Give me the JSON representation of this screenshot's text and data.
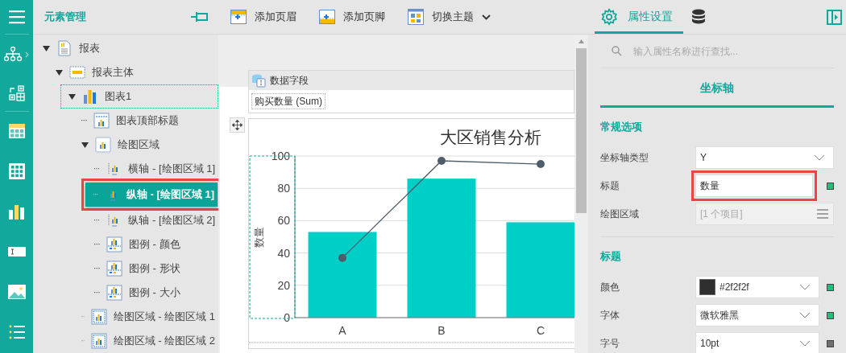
{
  "panel": {
    "title": "元素管理"
  },
  "tree": [
    {
      "label": "报表",
      "kind": "report",
      "expanded": true,
      "selected": false,
      "focused": false,
      "annotated": false,
      "children": [
        {
          "label": "报表主体",
          "kind": "body",
          "expanded": true,
          "selected": false,
          "focused": false,
          "annotated": false,
          "children": [
            {
              "label": "图表1",
              "kind": "chart",
              "expanded": true,
              "selected": false,
              "focused": true,
              "annotated": false,
              "children": [
                {
                  "label": "图表顶部标题",
                  "kind": "chart-title",
                  "expanded": false,
                  "selected": false,
                  "focused": false,
                  "annotated": false
                },
                {
                  "label": "绘图区域",
                  "kind": "plot",
                  "expanded": true,
                  "selected": false,
                  "focused": false,
                  "annotated": false,
                  "children": [
                    {
                      "label": "横轴 - [绘图区域 1]",
                      "kind": "axis",
                      "expanded": false,
                      "selected": false,
                      "focused": false,
                      "annotated": false
                    },
                    {
                      "label": "纵轴 - [绘图区域 1]",
                      "kind": "axis",
                      "expanded": false,
                      "selected": true,
                      "focused": false,
                      "annotated": true
                    },
                    {
                      "label": "纵轴 - [绘图区域 2]",
                      "kind": "axis",
                      "expanded": false,
                      "selected": false,
                      "focused": false,
                      "annotated": false
                    },
                    {
                      "label": "图例 - 颜色",
                      "kind": "legend",
                      "expanded": false,
                      "selected": false,
                      "focused": false,
                      "annotated": false
                    },
                    {
                      "label": "图例 - 形状",
                      "kind": "legend",
                      "expanded": false,
                      "selected": false,
                      "focused": false,
                      "annotated": false
                    },
                    {
                      "label": "图例 - 大小",
                      "kind": "legend",
                      "expanded": false,
                      "selected": false,
                      "focused": false,
                      "annotated": false
                    }
                  ]
                },
                {
                  "label": "绘图区域 - 绘图区域 1",
                  "kind": "plot-area",
                  "expanded": false,
                  "selected": false,
                  "focused": false,
                  "annotated": false
                },
                {
                  "label": "绘图区域 - 绘图区域 2",
                  "kind": "plot-area",
                  "expanded": false,
                  "selected": false,
                  "focused": false,
                  "annotated": false
                }
              ]
            }
          ]
        }
      ]
    }
  ],
  "toolbar": [
    {
      "label": "添加页眉",
      "kind": "header"
    },
    {
      "label": "添加页脚",
      "kind": "footer"
    },
    {
      "label": "切换主题",
      "kind": "theme"
    }
  ],
  "data_fields": {
    "title": "数据字段",
    "fields": [
      "购买数量 (Sum)"
    ]
  },
  "chart": {
    "chart_data": {
      "type": "bar",
      "grid": true,
      "title": "大区销售分析",
      "ylabel": "数量",
      "categories": [
        "A",
        "B",
        "C"
      ],
      "ylim": [
        0,
        100
      ],
      "yticks": [
        0,
        20,
        40,
        60,
        80,
        100
      ],
      "series": [
        {
          "type": "bar",
          "color": "#00cfc8",
          "values": [
            53,
            86,
            59
          ]
        },
        {
          "type": "line",
          "color": "#4f5d6b",
          "marker": "circle",
          "values": [
            37,
            97,
            95
          ]
        }
      ]
    }
  },
  "properties": {
    "tabs": [
      {
        "label": "属性设置",
        "kind": "settings",
        "selected": true
      },
      {
        "kind": "data",
        "selected": false
      }
    ],
    "search": {
      "placeholder": "输入属性名称进行查找..."
    },
    "section_tab": "坐标轴",
    "groups": [
      {
        "title": "常规选项",
        "rows": [
          {
            "label": "坐标轴类型",
            "kind": "select",
            "value": "Y",
            "annotated": false
          },
          {
            "label": "标题",
            "kind": "text",
            "value": "数量",
            "color": "#19c27a",
            "annotated": true
          },
          {
            "label": "绘图区域",
            "kind": "list",
            "value": "[1 个项目]",
            "annotated": false
          }
        ]
      },
      {
        "title": "标题",
        "rows": [
          {
            "label": "颜色",
            "kind": "color-select",
            "value": "#2f2f2f",
            "color": "#19c27a",
            "annotated": false
          },
          {
            "label": "字体",
            "kind": "select",
            "value": "微软雅黑",
            "color": "#19c27a",
            "annotated": false
          },
          {
            "label": "字号",
            "kind": "select",
            "value": "10pt",
            "color": "#6e6e6e",
            "annotated": false
          }
        ]
      }
    ]
  }
}
